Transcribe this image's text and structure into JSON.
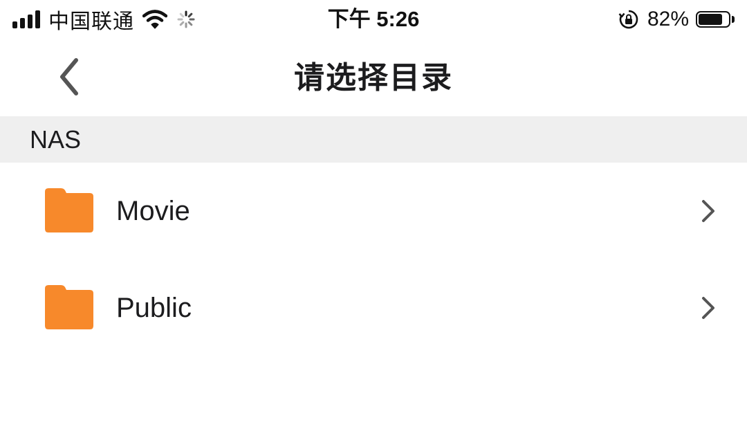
{
  "status_bar": {
    "carrier": "中国联通",
    "time": "下午 5:26",
    "battery_percent": "82%",
    "battery_level": 0.82,
    "icons": [
      "signal-bars-icon",
      "wifi-icon",
      "loading-spinner-icon",
      "rotation-lock-icon",
      "battery-icon"
    ]
  },
  "nav": {
    "title": "请选择目录",
    "back_icon": "chevron-left-icon"
  },
  "section": {
    "label": "NAS"
  },
  "folders": [
    {
      "name": "Movie",
      "icon": "folder-icon",
      "accessory": "chevron-right-icon"
    },
    {
      "name": "Public",
      "icon": "folder-icon",
      "accessory": "chevron-right-icon"
    }
  ],
  "colors": {
    "folder": "#f7892b",
    "section_background": "#efefef",
    "chevron": "#555555",
    "text": "#1c1c1e"
  }
}
